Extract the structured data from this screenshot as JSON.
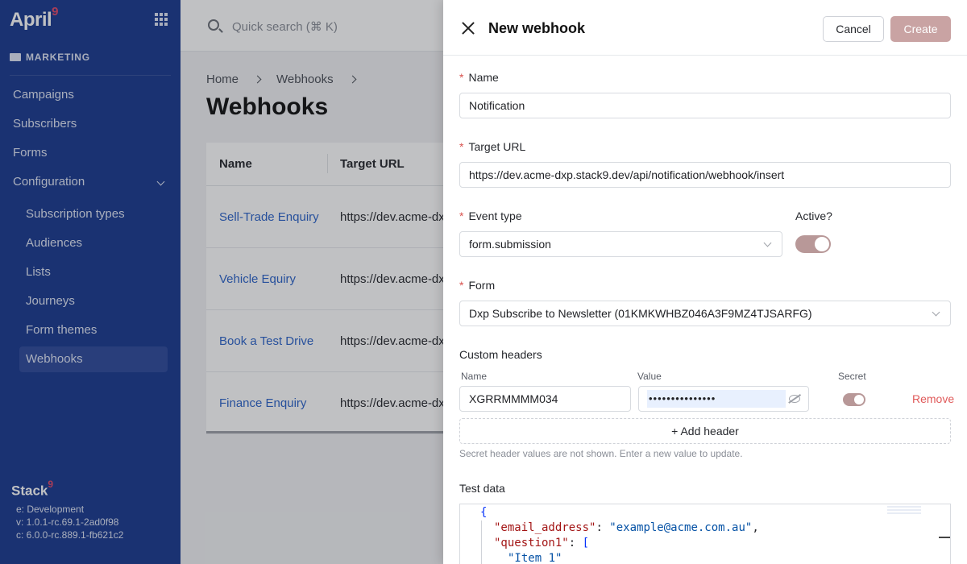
{
  "sidebar": {
    "logo": "April",
    "logo_super": "9",
    "section": "MARKETING",
    "items": [
      {
        "label": "Campaigns"
      },
      {
        "label": "Subscribers"
      },
      {
        "label": "Forms"
      },
      {
        "label": "Configuration"
      }
    ],
    "sub_items": [
      {
        "label": "Subscription types"
      },
      {
        "label": "Audiences"
      },
      {
        "label": "Lists"
      },
      {
        "label": "Journeys"
      },
      {
        "label": "Form themes"
      },
      {
        "label": "Webhooks",
        "active": true
      }
    ],
    "footer": {
      "logo": "Stack",
      "logo_super": "9",
      "env": "e: Development",
      "version": "v: 1.0.1-rc.69.1-2ad0f98",
      "core": "c: 6.0.0-rc.889.1-fb621c2"
    }
  },
  "topbar": {
    "search_placeholder": "Quick search (⌘ K)"
  },
  "breadcrumb": [
    "Home",
    "Webhooks"
  ],
  "page": {
    "title": "Webhooks",
    "columns": [
      "Name",
      "Target URL"
    ],
    "rows": [
      {
        "name": "Sell-Trade Enquiry",
        "url": "https://dev.acme-dx"
      },
      {
        "name": "Vehicle Equiry",
        "url": "https://dev.acme-dx"
      },
      {
        "name": "Book a Test Drive",
        "url": "https://dev.acme-dx"
      },
      {
        "name": "Finance Enquiry",
        "url": "https://dev.acme-dx"
      }
    ]
  },
  "drawer": {
    "title": "New webhook",
    "cancel": "Cancel",
    "create": "Create",
    "name_label": "Name",
    "name_value": "Notification",
    "url_label": "Target URL",
    "url_value": "https://dev.acme-dxp.stack9.dev/api/notification/webhook/insert",
    "event_label": "Event type",
    "event_value": "form.submission",
    "active_label": "Active?",
    "active": true,
    "form_label": "Form",
    "form_value": "Dxp Subscribe to Newsletter (01KMKWHBZ046A3F9MZ4TJSARFG)",
    "headers_label": "Custom headers",
    "header_cols": [
      "Name",
      "Value",
      "Secret"
    ],
    "header_row": {
      "name": "XGRRMMMM034",
      "value": "•••••••••••••••",
      "secret": true
    },
    "remove": "Remove",
    "add_header": "+ Add header",
    "hint": "Secret header values are not shown. Enter a new value to update.",
    "test_label": "Test data",
    "code": {
      "open": "{",
      "k1": "\"email_address\"",
      "v1": "\"example@acme.com.au\"",
      "k2": "\"question1\"",
      "v2": "\"Item 1\""
    }
  },
  "colors": {
    "sidebar": "#1a3a8f",
    "accent_link": "#2b63c9",
    "primary_disabled": "#c9a3a3",
    "danger": "#e05a5a"
  }
}
